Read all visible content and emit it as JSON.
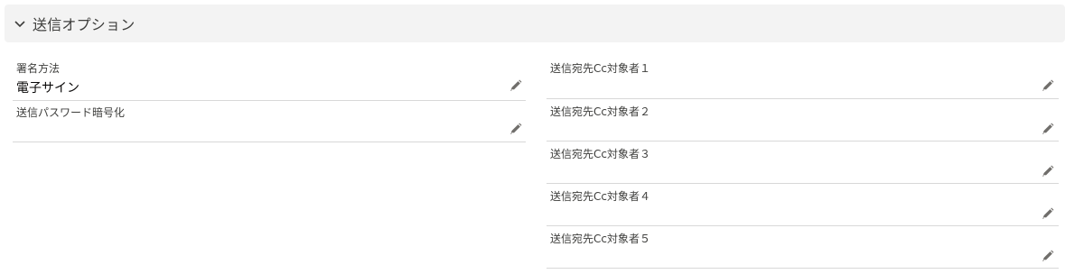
{
  "section": {
    "title": "送信オプション",
    "toggle_icon": "chevron-down-icon"
  },
  "left_fields": [
    {
      "label": "署名方法",
      "value": "電子サイン",
      "edit_icon": "pencil-icon"
    },
    {
      "label": "送信パスワード暗号化",
      "value": "",
      "edit_icon": "pencil-icon"
    }
  ],
  "right_fields": [
    {
      "label": "送信宛先Cc対象者１",
      "value": "",
      "edit_icon": "pencil-icon"
    },
    {
      "label": "送信宛先Cc対象者２",
      "value": "",
      "edit_icon": "pencil-icon"
    },
    {
      "label": "送信宛先Cc対象者３",
      "value": "",
      "edit_icon": "pencil-icon"
    },
    {
      "label": "送信宛先Cc対象者４",
      "value": "",
      "edit_icon": "pencil-icon"
    },
    {
      "label": "送信宛先Cc対象者５",
      "value": "",
      "edit_icon": "pencil-icon"
    }
  ],
  "colors": {
    "header_bg": "#f3f3f3",
    "divider": "#d8d8d8",
    "icon": "#706e6b"
  }
}
